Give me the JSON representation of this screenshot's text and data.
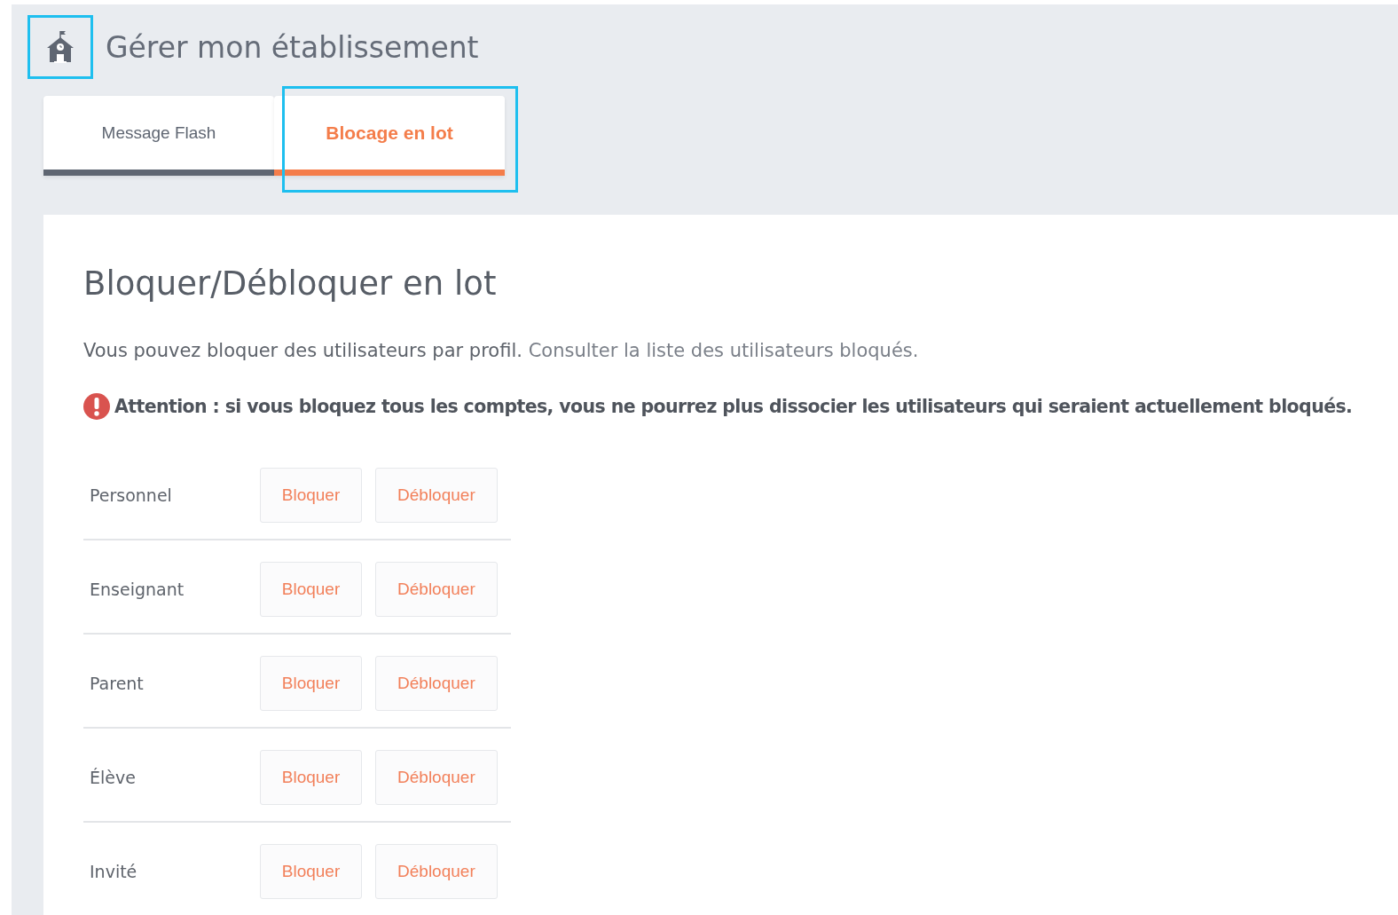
{
  "header": {
    "title": "Gérer mon établissement",
    "icon_highlighted": true
  },
  "tabs": [
    {
      "label": "Message Flash",
      "selected": false,
      "highlighted": false
    },
    {
      "label": "Blocage en lot",
      "selected": true,
      "highlighted": true
    }
  ],
  "panel": {
    "heading": "Bloquer/Débloquer en lot",
    "intro": "Vous pouvez bloquer des utilisateurs par profil.",
    "intro_link": "Consulter la liste des utilisateurs bloqués.",
    "warning": "Attention : si vous bloquez tous les comptes, vous ne pourrez plus dissocier les utilisateurs qui seraient actuellement bloqués.",
    "rows": [
      {
        "profile": "Personnel",
        "block": "Bloquer",
        "unblock": "Débloquer"
      },
      {
        "profile": "Enseignant",
        "block": "Bloquer",
        "unblock": "Débloquer"
      },
      {
        "profile": "Parent",
        "block": "Bloquer",
        "unblock": "Débloquer"
      },
      {
        "profile": "Élève",
        "block": "Bloquer",
        "unblock": "Débloquer"
      },
      {
        "profile": "Invité",
        "block": "Bloquer",
        "unblock": "Débloquer"
      }
    ]
  }
}
